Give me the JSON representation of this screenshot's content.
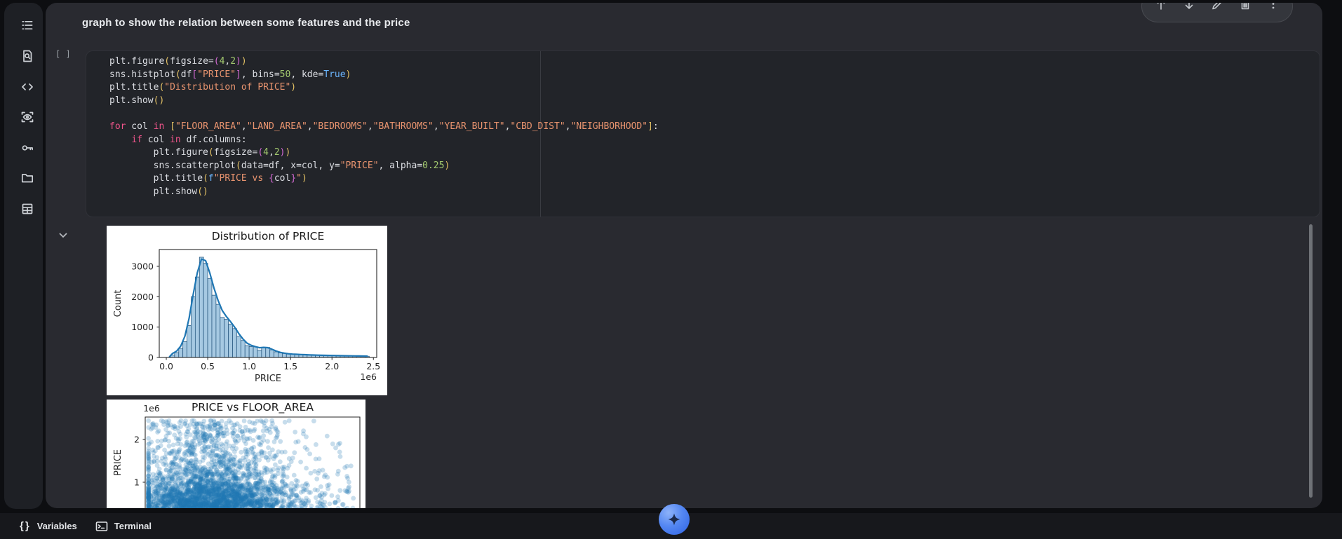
{
  "header": {
    "title": "graph to show the relation between some features and the price"
  },
  "sidebar": {
    "items": [
      {
        "icon": "table-of-contents"
      },
      {
        "icon": "find-and-replace"
      },
      {
        "icon": "code-snippets"
      },
      {
        "icon": "eye-scan"
      },
      {
        "icon": "secrets-key"
      },
      {
        "icon": "files-folder"
      },
      {
        "icon": "table-grid"
      }
    ]
  },
  "cell_toolbar": {
    "icons": [
      "move-cell-up",
      "move-cell-down",
      "edit",
      "delete",
      "more-options"
    ]
  },
  "code_cell": {
    "execution_indicator": "[ ]",
    "lines": [
      [
        {
          "t": "plt.figure",
          "c": "pln"
        },
        {
          "t": "(",
          "c": "b1"
        },
        {
          "t": "figsize=",
          "c": "pln"
        },
        {
          "t": "(",
          "c": "b2"
        },
        {
          "t": "4",
          "c": "num"
        },
        {
          "t": ",",
          "c": "pln"
        },
        {
          "t": "2",
          "c": "num"
        },
        {
          "t": ")",
          "c": "b2"
        },
        {
          "t": ")",
          "c": "b1"
        }
      ],
      [
        {
          "t": "sns.histplot",
          "c": "pln"
        },
        {
          "t": "(",
          "c": "b1"
        },
        {
          "t": "df",
          "c": "pln"
        },
        {
          "t": "[",
          "c": "b2"
        },
        {
          "t": "\"PRICE\"",
          "c": "str"
        },
        {
          "t": "]",
          "c": "b2"
        },
        {
          "t": ", bins=",
          "c": "pln"
        },
        {
          "t": "50",
          "c": "num"
        },
        {
          "t": ", kde=",
          "c": "pln"
        },
        {
          "t": "True",
          "c": "bool"
        },
        {
          "t": ")",
          "c": "b1"
        }
      ],
      [
        {
          "t": "plt.title",
          "c": "pln"
        },
        {
          "t": "(",
          "c": "b1"
        },
        {
          "t": "\"Distribution of PRICE\"",
          "c": "str"
        },
        {
          "t": ")",
          "c": "b1"
        }
      ],
      [
        {
          "t": "plt.show",
          "c": "pln"
        },
        {
          "t": "()",
          "c": "b1"
        }
      ],
      [],
      [
        {
          "t": "for",
          "c": "kw"
        },
        {
          "t": " col ",
          "c": "pln"
        },
        {
          "t": "in",
          "c": "kw"
        },
        {
          "t": " ",
          "c": "pln"
        },
        {
          "t": "[",
          "c": "b1"
        },
        {
          "t": "\"FLOOR_AREA\"",
          "c": "str"
        },
        {
          "t": ",",
          "c": "pln"
        },
        {
          "t": "\"LAND_AREA\"",
          "c": "str"
        },
        {
          "t": ",",
          "c": "pln"
        },
        {
          "t": "\"BEDROOMS\"",
          "c": "str"
        },
        {
          "t": ",",
          "c": "pln"
        },
        {
          "t": "\"BATHROOMS\"",
          "c": "str"
        },
        {
          "t": ",",
          "c": "pln"
        },
        {
          "t": "\"YEAR_BUILT\"",
          "c": "str"
        },
        {
          "t": ",",
          "c": "pln"
        },
        {
          "t": "\"CBD_DIST\"",
          "c": "str"
        },
        {
          "t": ",",
          "c": "pln"
        },
        {
          "t": "\"NEIGHBORHOOD\"",
          "c": "str"
        },
        {
          "t": "]",
          "c": "b1"
        },
        {
          "t": ":",
          "c": "pln"
        }
      ],
      [
        {
          "t": "    ",
          "c": "pln"
        },
        {
          "t": "if",
          "c": "kw"
        },
        {
          "t": " col ",
          "c": "pln"
        },
        {
          "t": "in",
          "c": "kw"
        },
        {
          "t": " df.columns:",
          "c": "pln"
        }
      ],
      [
        {
          "t": "        plt.figure",
          "c": "pln"
        },
        {
          "t": "(",
          "c": "b1"
        },
        {
          "t": "figsize=",
          "c": "pln"
        },
        {
          "t": "(",
          "c": "b2"
        },
        {
          "t": "4",
          "c": "num"
        },
        {
          "t": ",",
          "c": "pln"
        },
        {
          "t": "2",
          "c": "num"
        },
        {
          "t": ")",
          "c": "b2"
        },
        {
          "t": ")",
          "c": "b1"
        }
      ],
      [
        {
          "t": "        sns.scatterplot",
          "c": "pln"
        },
        {
          "t": "(",
          "c": "b1"
        },
        {
          "t": "data=df, x=col, y=",
          "c": "pln"
        },
        {
          "t": "\"PRICE\"",
          "c": "str"
        },
        {
          "t": ", alpha=",
          "c": "pln"
        },
        {
          "t": "0.25",
          "c": "num"
        },
        {
          "t": ")",
          "c": "b1"
        }
      ],
      [
        {
          "t": "        plt.title",
          "c": "pln"
        },
        {
          "t": "(",
          "c": "b1"
        },
        {
          "t": "f",
          "c": "bool"
        },
        {
          "t": "\"PRICE vs ",
          "c": "str"
        },
        {
          "t": "{",
          "c": "b2"
        },
        {
          "t": "col",
          "c": "pln"
        },
        {
          "t": "}",
          "c": "b2"
        },
        {
          "t": "\"",
          "c": "str"
        },
        {
          "t": ")",
          "c": "b1"
        }
      ],
      [
        {
          "t": "        plt.show",
          "c": "pln"
        },
        {
          "t": "()",
          "c": "b1"
        }
      ]
    ]
  },
  "chart_data": [
    {
      "type": "histogram",
      "title": "Distribution of PRICE",
      "xlabel": "PRICE",
      "ylabel": "Count",
      "x_offset_label": "1e6",
      "xticks": [
        0.0,
        0.5,
        1.0,
        1.5,
        2.0,
        2.5
      ],
      "yticks": [
        0,
        1000,
        2000,
        3000
      ],
      "xlim": [
        -0.085,
        2.54
      ],
      "ymax": 3553,
      "bin_start": 0.05,
      "bin_width": 0.05,
      "counts": [
        80,
        160,
        300,
        520,
        1050,
        2000,
        2650,
        3300,
        3100,
        2600,
        2050,
        1750,
        1320,
        1260,
        1100,
        950,
        700,
        560,
        390,
        360,
        350,
        240,
        330,
        330,
        250,
        185,
        150,
        130,
        110,
        100,
        95,
        90,
        85,
        80,
        75,
        70,
        65,
        65,
        60,
        60,
        55,
        55,
        50,
        50,
        48,
        45,
        42,
        40
      ],
      "kde": true,
      "bar_fill": "#a6c9e2",
      "bar_edge": "#2e5d84",
      "kde_color": "#1f77b4",
      "text_color": "#262626"
    },
    {
      "type": "scatter",
      "title": "PRICE vs FLOOR_AREA",
      "ylabel": "PRICE",
      "y_offset_label": "1e6",
      "yticks": [
        1,
        2
      ],
      "alpha": 0.25,
      "point_color": "#1f77b4",
      "n_points": 3200,
      "y_clamp_max": 2.44,
      "note": "dense translucent cloud, figure cut off by viewport bottom",
      "text_color": "#262626"
    }
  ],
  "bottom_bar": {
    "variables_label": "Variables",
    "terminal_label": "Terminal"
  },
  "colors": {
    "accent_blue": "#1f77b4",
    "gemini_blue": "#4a7df0",
    "panel_bg": "#292a30",
    "cell_bg": "#222429",
    "sidebar_bg": "#1e2025",
    "bottom_bar_bg": "#17181c"
  }
}
